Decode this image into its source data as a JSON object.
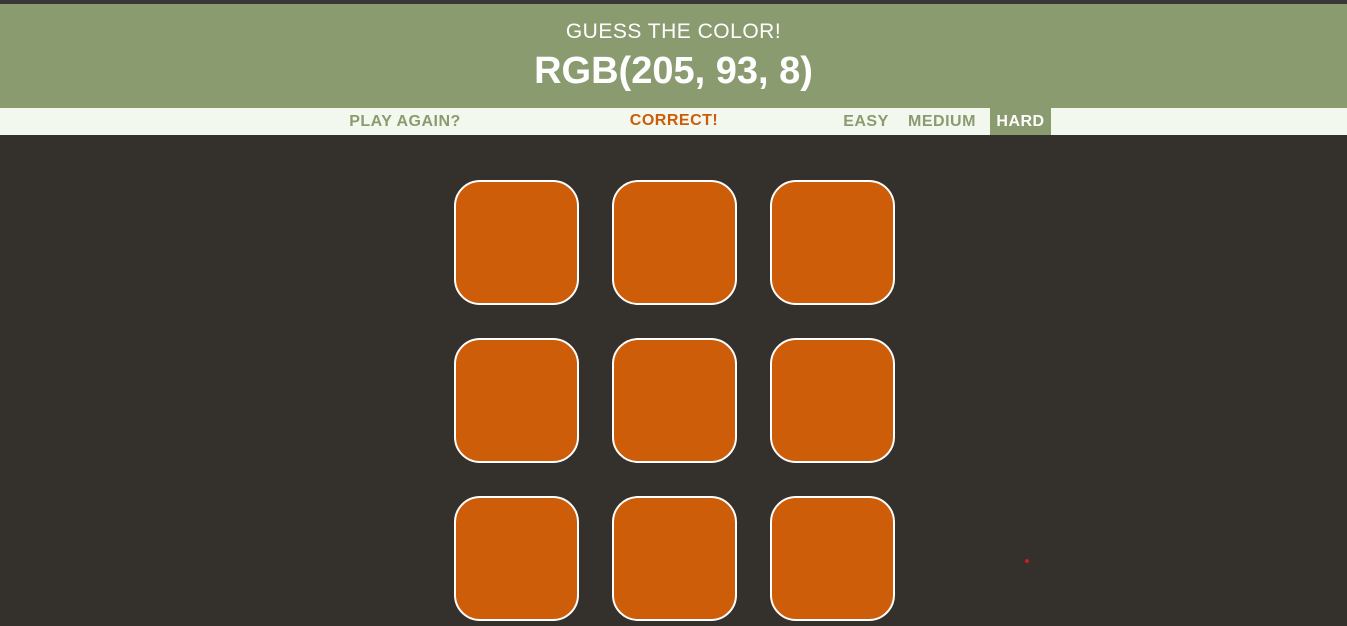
{
  "header": {
    "subtitle": "GUESS THE COLOR!",
    "rgb_display": "RGB(205, 93, 8)",
    "background_color": "#8b9b70"
  },
  "controls": {
    "play_again_label": "PLAY AGAIN?",
    "message": "CORRECT!",
    "difficulty_options": [
      "EASY",
      "MEDIUM",
      "HARD"
    ],
    "selected_difficulty": "HARD"
  },
  "board": {
    "square_count": 9,
    "square_colors": [
      "#cd5d08",
      "#cd5d08",
      "#cd5d08",
      "#cd5d08",
      "#cd5d08",
      "#cd5d08",
      "#cd5d08",
      "#cd5d08",
      "#cd5d08"
    ],
    "background_color": "#34302c"
  }
}
